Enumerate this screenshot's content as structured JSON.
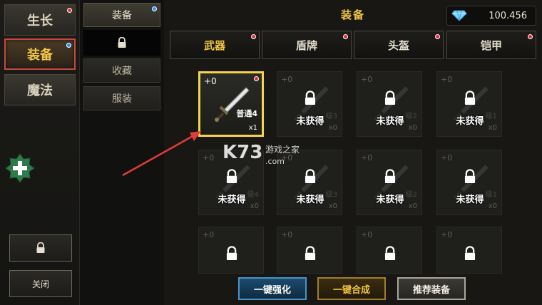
{
  "left_rail": {
    "tabs": [
      {
        "label": "生长",
        "badge": "red"
      },
      {
        "label": "装备",
        "badge": "blue"
      },
      {
        "label": "魔法",
        "badge": ""
      }
    ],
    "close_label": "关闭"
  },
  "sub_tabs": {
    "equip_label": "装备",
    "collect_label": "收藏",
    "costume_label": "服装"
  },
  "header": {
    "title": "装备",
    "currency_value": "100.456"
  },
  "categories": [
    "武器",
    "盾牌",
    "头盔",
    "铠甲"
  ],
  "grid": {
    "selected_item": {
      "plus": "+0",
      "grade": "普通4",
      "qty": "x1"
    },
    "rows": [
      [
        {
          "plus": "+0",
          "status": "未获得",
          "ghost": "级3",
          "qty": "x0"
        },
        {
          "plus": "+0",
          "status": "未获得",
          "ghost": "级2",
          "qty": "x0"
        },
        {
          "plus": "+0",
          "status": "未获得",
          "ghost": "级1",
          "qty": "x0"
        }
      ],
      [
        {
          "plus": "+0",
          "status": "未获得",
          "ghost": "级4",
          "qty": "x0"
        },
        {
          "plus": "+0",
          "status": "未获得",
          "ghost": "级3",
          "qty": "x0"
        },
        {
          "plus": "+0",
          "status": "未获得",
          "ghost": "级2",
          "qty": "x0"
        },
        {
          "plus": "+0",
          "status": "未获得",
          "ghost": "级1",
          "qty": "x0"
        }
      ],
      [
        {
          "plus": "+0",
          "status": ""
        },
        {
          "plus": "+0",
          "status": ""
        },
        {
          "plus": "+0",
          "status": ""
        },
        {
          "plus": "+0",
          "status": ""
        }
      ]
    ]
  },
  "watermark": {
    "brand": "K73",
    "subtitle": "游戏之家",
    "domain": ".com"
  },
  "actions": {
    "enhance_label": "一键强化",
    "synthesize_label": "一键合成",
    "recommend_label": "推荐装备"
  },
  "colors": {
    "accent_gold": "#f2c540",
    "active_border": "#c9473f",
    "badge_red": "#e02d2d",
    "badge_blue": "#2e8cff"
  }
}
